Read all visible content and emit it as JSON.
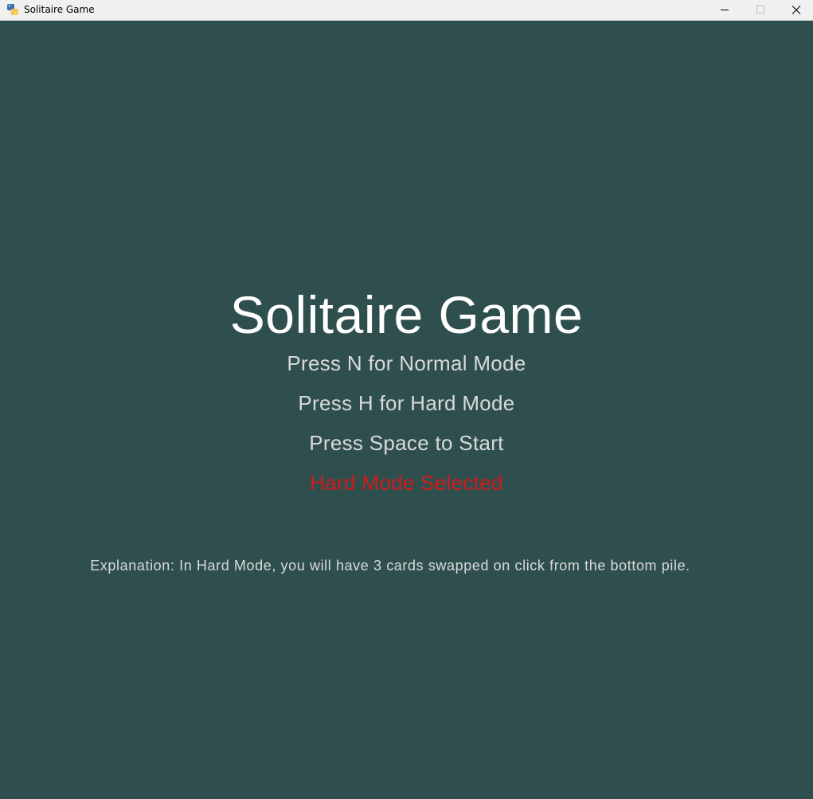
{
  "window": {
    "title": "Solitaire Game"
  },
  "icons": {
    "app": "python-icon",
    "minimize": "minimize-icon",
    "maximize": "maximize-icon",
    "close": "close-icon"
  },
  "menu": {
    "title": "Solitaire Game",
    "normal_mode": "Press N for Normal Mode",
    "hard_mode": "Press H for Hard Mode",
    "start": "Press Space to Start",
    "selected_mode": "Hard Mode Selected",
    "explanation": "Explanation: In Hard Mode, you will have 3 cards swapped on click from the bottom pile."
  },
  "colors": {
    "background": "#2f4f4f",
    "title_text": "#ffffff",
    "menu_text": "#d9d9d9",
    "selected_text": "#d11a1a"
  }
}
